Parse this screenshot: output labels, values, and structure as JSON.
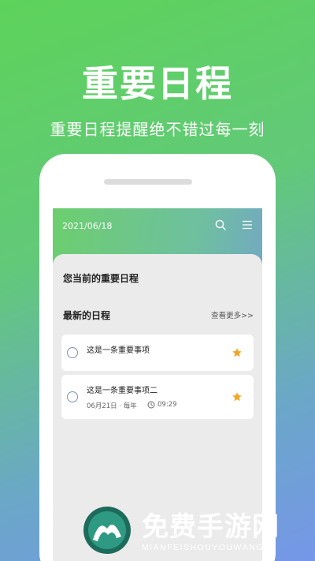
{
  "hero": {
    "title": "重要日程",
    "subtitle": "重要日程提醒绝不错过每一刻"
  },
  "app": {
    "date": "2021/06/18",
    "current_section_title": "您当前的重要日程",
    "latest_section_title": "最新的日程",
    "more_link": "查看更多>>",
    "items": [
      {
        "title": "这是一条重要事项",
        "starred": true
      },
      {
        "title": "这是一条重要事项二",
        "meta": "06月21日 · 每年",
        "time": "09:29",
        "starred": true
      }
    ]
  },
  "watermark": {
    "brand_cn": "免费手游网",
    "brand_en": "MIANFEISHOUYOUWANG"
  },
  "colors": {
    "accent_star": "#f3a623",
    "radio": "#7b8fb8"
  }
}
